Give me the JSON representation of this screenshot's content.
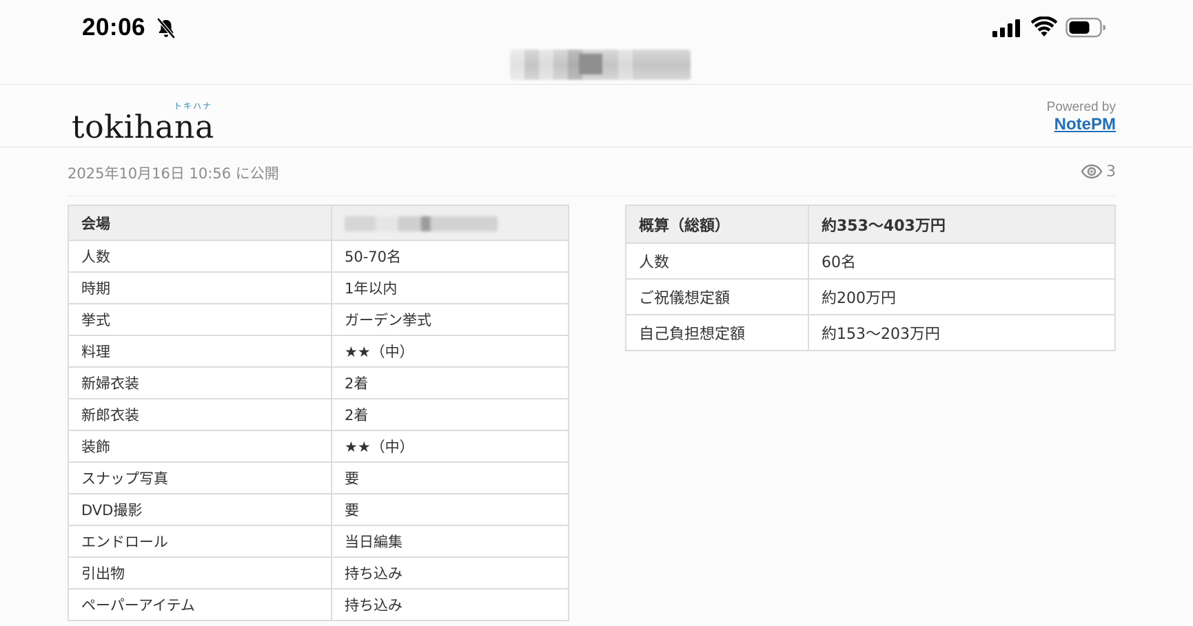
{
  "status_bar": {
    "time": "20:06",
    "icons": [
      "bell-slash-icon",
      "cellular-signal-icon",
      "wifi-icon",
      "battery-icon"
    ]
  },
  "header": {
    "logo": "tokihana",
    "logo_ruby": "トキハナ",
    "powered_label": "Powered by",
    "powered_link": "NotePM"
  },
  "meta": {
    "published": "2025年10月16日 10:56 に公開",
    "views": "3"
  },
  "conditions_table": {
    "header_key": "会場",
    "rows": [
      {
        "key": "人数",
        "value": "50-70名"
      },
      {
        "key": "時期",
        "value": "1年以内"
      },
      {
        "key": "挙式",
        "value": "ガーデン挙式"
      },
      {
        "key": "料理",
        "value": "★★（中）"
      },
      {
        "key": "新婦衣装",
        "value": "2着"
      },
      {
        "key": "新郎衣装",
        "value": "2着"
      },
      {
        "key": "装飾",
        "value": "★★（中）"
      },
      {
        "key": "スナップ写真",
        "value": "要"
      },
      {
        "key": "DVD撮影",
        "value": "要"
      },
      {
        "key": "エンドロール",
        "value": "当日編集"
      },
      {
        "key": "引出物",
        "value": "持ち込み"
      },
      {
        "key": "ペーパーアイテム",
        "value": "持ち込み"
      }
    ]
  },
  "estimate_table": {
    "header_key": "概算（総額）",
    "header_value": "約353〜403万円",
    "rows": [
      {
        "key": "人数",
        "value": "60名"
      },
      {
        "key": "ご祝儀想定額",
        "value": "約200万円"
      },
      {
        "key": "自己負担想定額",
        "value": "約153〜203万円"
      }
    ]
  },
  "colors": {
    "link": "#1f6fba",
    "logo_ruby": "#3a8bb7",
    "table_header_bg": "#efefef",
    "border": "#dcdcdc"
  }
}
